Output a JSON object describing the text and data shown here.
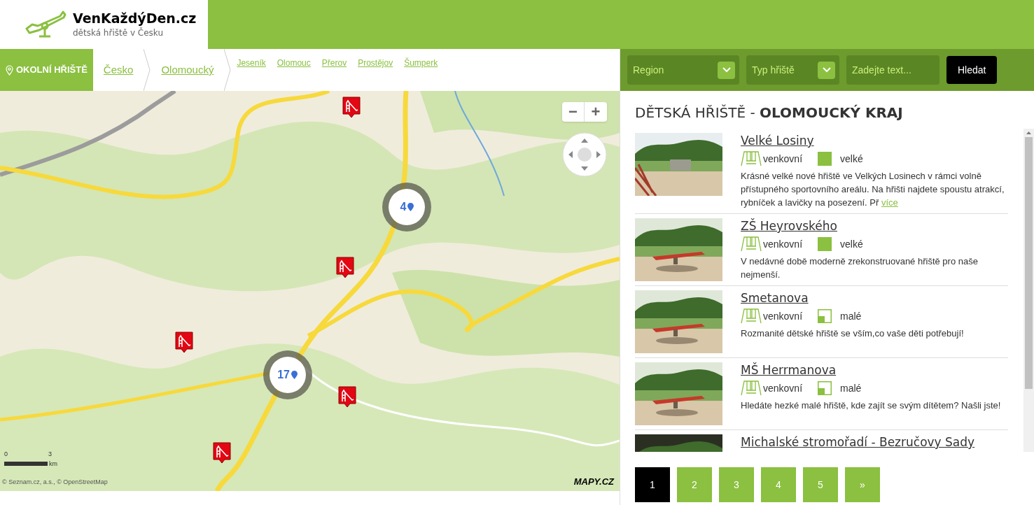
{
  "logo": {
    "title": "VenKaždýDen.cz",
    "subtitle": "dětská hřiště v Česku"
  },
  "breadcrumb": {
    "nearby": "OKOLNÍ HŘIŠTĚ",
    "crumbs": [
      "Česko",
      "Olomoucký"
    ],
    "districts": [
      "Jeseník",
      "Olomouc",
      "Přerov",
      "Prostějov",
      "Šumperk"
    ]
  },
  "map": {
    "zoom_out": "−",
    "zoom_in": "+",
    "clusters": [
      {
        "count": "4"
      },
      {
        "count": "17"
      }
    ],
    "markers": [
      {
        "kind": "slide"
      },
      {
        "kind": "slide"
      },
      {
        "kind": "slide"
      },
      {
        "kind": "slide"
      },
      {
        "kind": "slide"
      }
    ],
    "scale": {
      "start": "0",
      "end": "3",
      "unit": "km"
    },
    "attribution": "© Seznam.cz, a.s., © OpenStreetMap",
    "brand": "MAPY.CZ"
  },
  "filters": {
    "region": "Region",
    "type": "Typ hřiště",
    "search_placeholder": "Zadejte text...",
    "search_button": "Hledat"
  },
  "heading": {
    "prefix": "DĚTSKÁ HŘIŠTĚ - ",
    "region": "OLOMOUCKÝ KRAJ"
  },
  "playgrounds": [
    {
      "name": "Velké Losiny",
      "setting": "venkovní",
      "size": "velké",
      "kind": "large",
      "text": "Krásné velké nové hřiště ve Velkých Losinech v rámci volně přístupného sportovního areálu. Na hřišti najdete spoustu atrakcí, rybníček a lavičky na posezení. Př",
      "more": "více"
    },
    {
      "name": "ZŠ Heyrovského",
      "setting": "venkovní",
      "size": "velké",
      "kind": "large",
      "text": "V nedávné době moderně zrekonstruované hřiště pro naše nejmenší."
    },
    {
      "name": "Smetanova",
      "setting": "venkovní",
      "size": "malé",
      "kind": "small",
      "text": "Rozmanité dětské hřiště se vším,co vaše děti potřebují!"
    },
    {
      "name": "MŠ Herrmanova",
      "setting": "venkovní",
      "size": "malé",
      "kind": "small",
      "text": "Hledáte hezké malé hřiště, kde zajít se svým dítětem? Našli jste!"
    },
    {
      "name": "Michalské stromořadí - Bezručovy Sady"
    }
  ],
  "pagination": [
    {
      "label": "1",
      "selected": true
    },
    {
      "label": "2",
      "selected": false
    },
    {
      "label": "3",
      "selected": false
    },
    {
      "label": "4",
      "selected": false
    },
    {
      "label": "5",
      "selected": false
    },
    {
      "label": "»",
      "selected": false
    }
  ]
}
